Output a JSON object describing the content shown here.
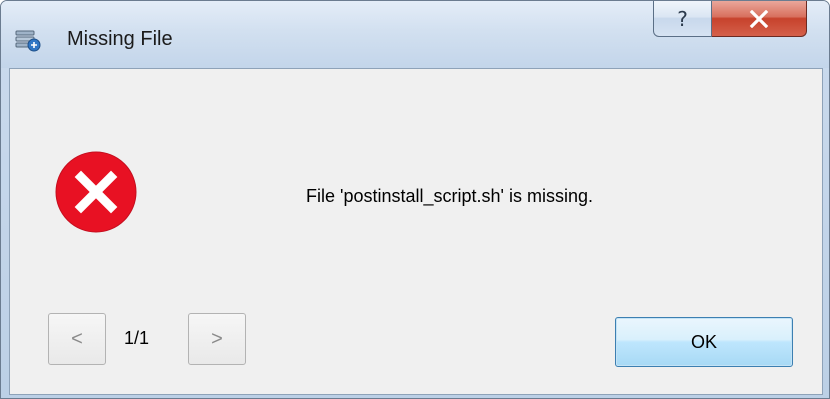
{
  "window": {
    "title": "Missing File",
    "help_label": "?",
    "icon": "app-icon"
  },
  "dialog": {
    "icon": "error-icon",
    "message": "File 'postinstall_script.sh' is missing."
  },
  "navigation": {
    "prev_label": "<",
    "next_label": ">",
    "page_indicator": "1/1"
  },
  "buttons": {
    "ok_label": "OK"
  },
  "colors": {
    "error_red": "#e81123",
    "ok_border": "#3c7fb1",
    "close_red": "#c7422c"
  }
}
